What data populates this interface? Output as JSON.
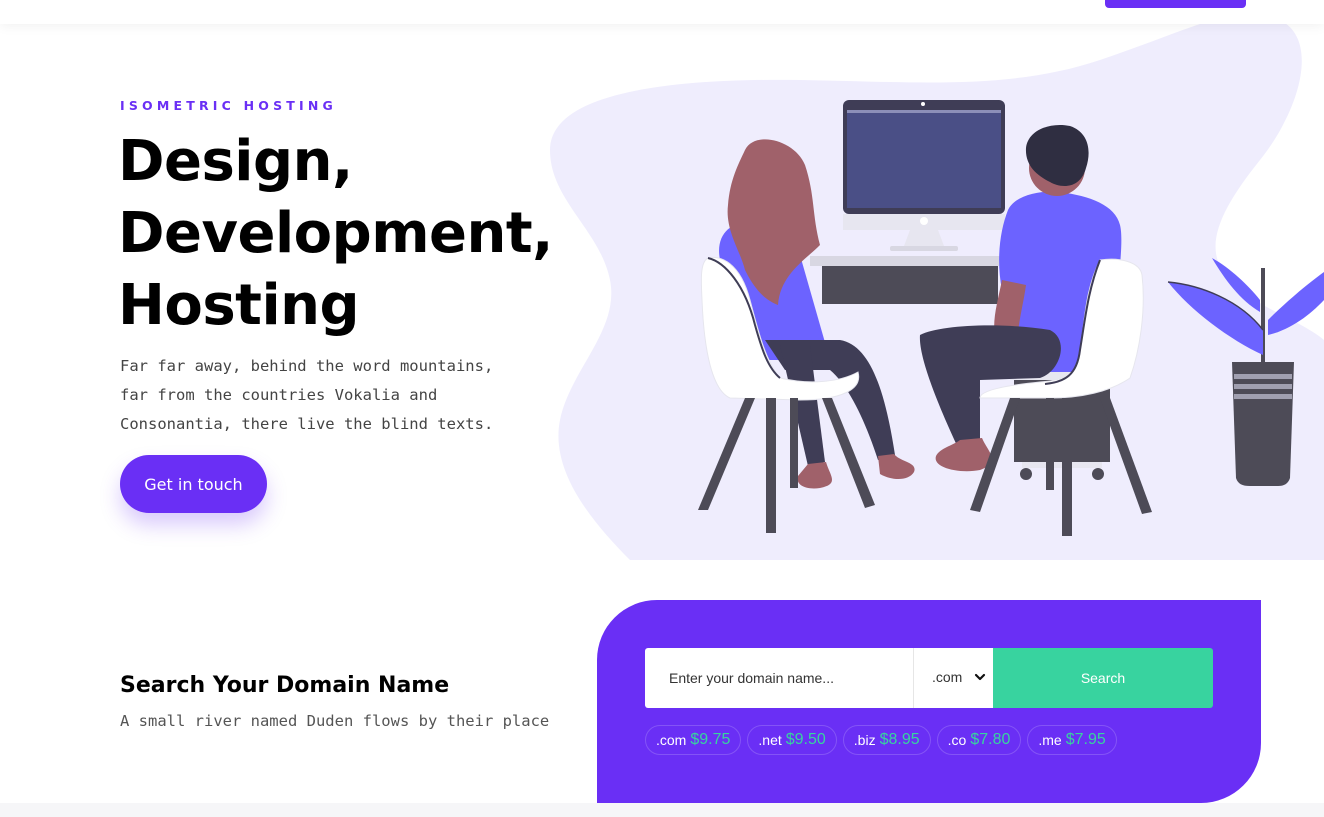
{
  "colors": {
    "accent": "#6a2ff5",
    "success": "#38d39f",
    "blob": "#efedfd",
    "text": "#000000",
    "muted": "#555555"
  },
  "hero": {
    "eyebrow": "ISOMETRIC HOSTING",
    "headline": [
      "Design,",
      "Development,",
      "Hosting"
    ],
    "lead": "Far far away, behind the word mountains, far from the countries Vokalia and Consonantia, there live the blind texts.",
    "cta_label": "Get in touch"
  },
  "domain": {
    "title": "Search Your Domain Name",
    "subtitle": "A small river named Duden flows by their place",
    "search": {
      "placeholder": "Enter your domain name...",
      "value": ""
    },
    "tld_selected": ".com",
    "tld_icon": "chevron-down-icon",
    "search_label": "Search",
    "prices": [
      {
        "ext": ".com",
        "price": "$9.75"
      },
      {
        "ext": ".net",
        "price": "$9.50"
      },
      {
        "ext": ".biz",
        "price": "$8.95"
      },
      {
        "ext": ".co",
        "price": "$7.80"
      },
      {
        "ext": ".me",
        "price": "$7.95"
      }
    ]
  }
}
